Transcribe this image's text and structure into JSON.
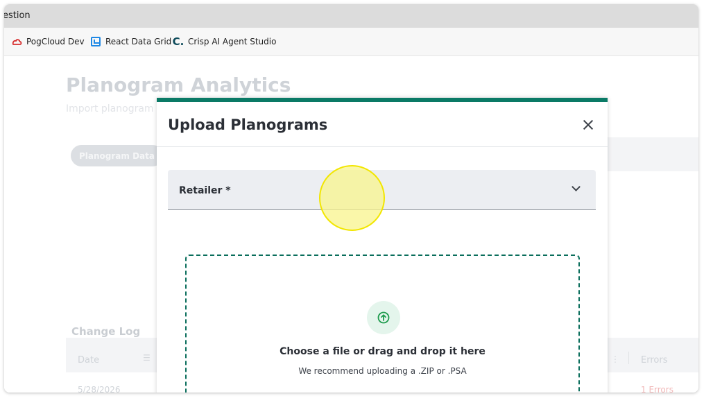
{
  "window": {
    "title": "estion"
  },
  "bookmarks": [
    {
      "label": "PogCloud Dev",
      "icon": "cloud-icon"
    },
    {
      "label": "React Data Grid",
      "icon": "react-data-grid-icon"
    },
    {
      "label": "Crisp AI Agent Studio",
      "icon": "crisp-icon",
      "icon_glyph": "C."
    }
  ],
  "page": {
    "title": "Planogram Analytics",
    "subtitle": "Import planogram",
    "tab": "Planogram Data",
    "changelog": {
      "title": "Change Log",
      "columns": {
        "date": "Date",
        "errors": "Errors"
      },
      "rows": [
        {
          "date": "5/28/2026",
          "errors": "1 Errors"
        }
      ]
    }
  },
  "modal": {
    "title": "Upload Planograms",
    "retailer_label": "Retailer *",
    "dropzone": {
      "title": "Choose a file or drag and drop it here",
      "hint": "We recommend uploading a .ZIP or .PSA"
    }
  },
  "colors": {
    "accent": "#0a7a66",
    "highlight": "#f8f48c"
  }
}
